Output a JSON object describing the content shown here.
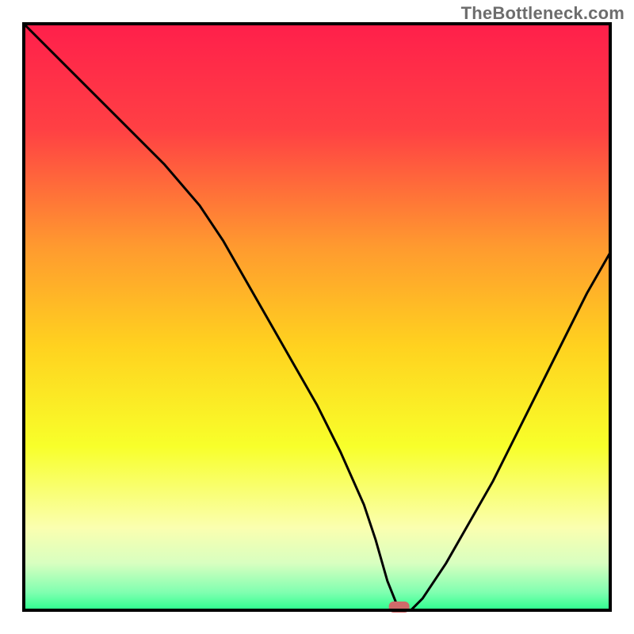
{
  "watermark": {
    "text": "TheBottleneck.com"
  },
  "chart_data": {
    "type": "line",
    "title": "",
    "xlabel": "",
    "ylabel": "",
    "xlim": [
      0,
      100
    ],
    "ylim": [
      0,
      100
    ],
    "grid": false,
    "legend": false,
    "optimal_marker": {
      "x": 64,
      "y": 0,
      "color": "#cf6a6a"
    },
    "series": [
      {
        "name": "bottleneck-curve",
        "x": [
          0,
          6,
          12,
          18,
          24,
          30,
          34,
          38,
          42,
          46,
          50,
          54,
          58,
          60,
          62,
          64,
          66,
          68,
          72,
          76,
          80,
          84,
          88,
          92,
          96,
          100
        ],
        "values": [
          100,
          94,
          88,
          82,
          76,
          69,
          63,
          56,
          49,
          42,
          35,
          27,
          18,
          12,
          5,
          0,
          0,
          2,
          8,
          15,
          22,
          30,
          38,
          46,
          54,
          61
        ]
      }
    ],
    "background_gradient": {
      "stops": [
        {
          "offset": 0.0,
          "color": "#ff1f4b"
        },
        {
          "offset": 0.18,
          "color": "#ff4044"
        },
        {
          "offset": 0.38,
          "color": "#ff9a2f"
        },
        {
          "offset": 0.55,
          "color": "#ffd21f"
        },
        {
          "offset": 0.72,
          "color": "#f8ff2a"
        },
        {
          "offset": 0.86,
          "color": "#faffb0"
        },
        {
          "offset": 0.92,
          "color": "#d8ffc0"
        },
        {
          "offset": 0.97,
          "color": "#7fffb0"
        },
        {
          "offset": 1.0,
          "color": "#2cff8e"
        }
      ]
    }
  }
}
